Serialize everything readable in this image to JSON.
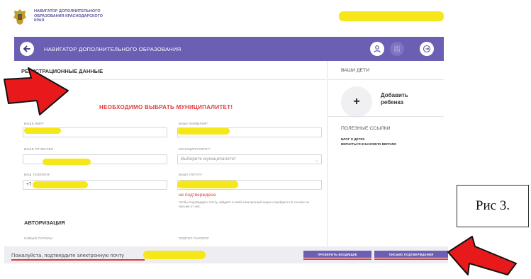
{
  "header": {
    "org_line1": "НАВИГАТОР ДОПОЛНИТЕЛЬНОГО",
    "org_line2": "ОБРАЗОВАНИЯ КРАСНОДАРСКОГО",
    "org_line3": "КРАЯ"
  },
  "nav": {
    "title": "НАВИГАТОР ДОПОЛНИТЕЛЬНОГО ОБРАЗОВАНИЯ"
  },
  "form": {
    "section_title": "РЕГИСТРАЦИОННЫЕ ДАННЫЕ",
    "error": "НЕОБХОДИМО ВЫБРАТЬ МУНИЦИПАЛИТЕТ!",
    "first_name_label": "ВАШЕ ИМЯ*",
    "last_name_label": "ВАША ФАМИЛИЯ*",
    "patronymic_label": "ВАШЕ ОТЧЕСТВО",
    "municipality_label": "МУНИЦИПАЛИТЕТ*",
    "municipality_placeholder": "Выберите муниципалитет",
    "phone_label": "ВАШ ТЕЛЕФОН*",
    "phone_value": "+7",
    "email_label": "ВАША ПОЧТА*",
    "email_status": "не подтверждена",
    "email_hint": "Чтобы подтвердить почту, зайдите в свой электронный ящик и пройдите по ссылке из письма от нас.",
    "auth_title": "АВТОРИЗАЦИЯ",
    "new_password_label": "НОВЫЙ ПАРОЛЬ*",
    "repeat_password_label": "ПОВТОР ПАРОЛЯ*"
  },
  "sidebar": {
    "children_title": "ВАШИ ДЕТИ",
    "add_child_line1": "Добавить",
    "add_child_line2": "ребенка",
    "links_title": "ПОЛЕЗНЫЕ ССЫЛКИ",
    "link_blog": "БЛОГ О ДЕТЯХ",
    "link_basic": "ВЕРНУТЬСЯ В БАЗОВУЮ ВЕРСИЮ"
  },
  "bottom": {
    "message": "Пожалуйста, подтвердите электронную почту",
    "check_inbox": "ПРОВЕРИТЬ ВХОДЯЩИЕ",
    "resend": "ПИСЬМО ПОДТВЕРЖДЕНИЯ"
  },
  "caption": "Рис 3.",
  "colors": {
    "brand": "#6a5fb2",
    "error": "#e03b3b",
    "highlight": "#f6e71a",
    "arrow": "#e8191b"
  },
  "icons": {
    "back": "arrow-left-icon",
    "profile": "user-icon",
    "settings": "sliders-icon",
    "logout": "logout-icon",
    "add": "plus-icon",
    "dropdown": "chevron-down-icon"
  }
}
